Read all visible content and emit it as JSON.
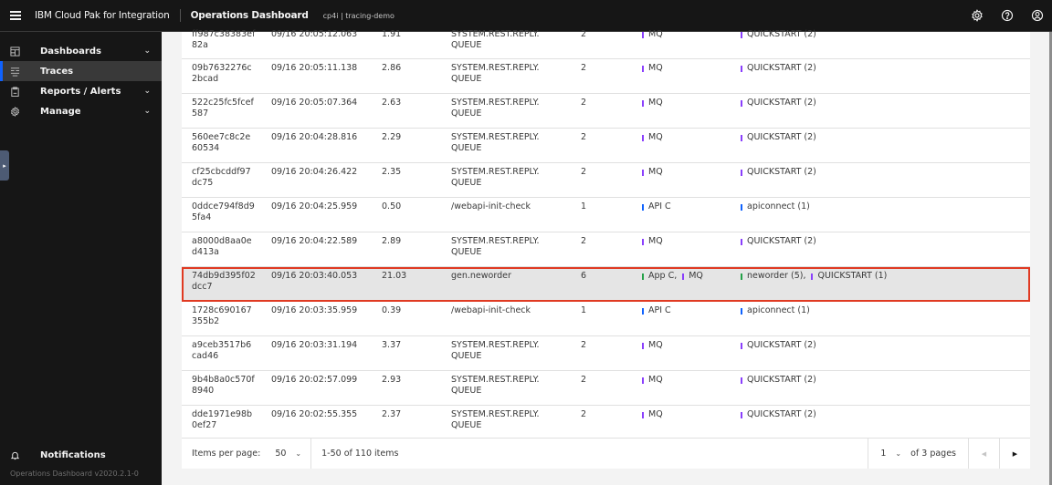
{
  "header": {
    "brand": "IBM Cloud Pak for Integration",
    "app_title": "Operations Dashboard",
    "namespace": "cp4i | tracing-demo",
    "icons": [
      "gear-icon",
      "help-icon",
      "user-avatar-icon"
    ]
  },
  "sidebar": {
    "items": [
      {
        "label": "Dashboards",
        "icon": "dashboard-icon",
        "expandable": true,
        "active": false
      },
      {
        "label": "Traces",
        "icon": "traces-icon",
        "expandable": false,
        "active": true
      },
      {
        "label": "Reports / Alerts",
        "icon": "clipboard-icon",
        "expandable": true,
        "active": false
      },
      {
        "label": "Manage",
        "icon": "gear-icon",
        "expandable": true,
        "active": false
      }
    ],
    "notifications_label": "Notifications",
    "version": "Operations Dashboard v2020.2.1-0"
  },
  "colors": {
    "mq": "#8a3ffc",
    "api": "#0f62fe",
    "app": "#24a148",
    "highlight_border": "#e03a22",
    "active_nav": "#0f62fe"
  },
  "table": {
    "rows": [
      {
        "id": "ff987c38383ef82a",
        "time": "09/16 20:05:12.063",
        "duration": "1.91",
        "name": "SYSTEM.REST.REPLY.QUEUE",
        "spans": "2",
        "types": [
          {
            "label": "MQ",
            "color": "mq"
          }
        ],
        "services": [
          {
            "label": "QUICKSTART (2)",
            "color": "mq"
          }
        ]
      },
      {
        "id": "09b7632276c2bcad",
        "time": "09/16 20:05:11.138",
        "duration": "2.86",
        "name": "SYSTEM.REST.REPLY.QUEUE",
        "spans": "2",
        "types": [
          {
            "label": "MQ",
            "color": "mq"
          }
        ],
        "services": [
          {
            "label": "QUICKSTART (2)",
            "color": "mq"
          }
        ]
      },
      {
        "id": "522c25fc5fcef587",
        "time": "09/16 20:05:07.364",
        "duration": "2.63",
        "name": "SYSTEM.REST.REPLY.QUEUE",
        "spans": "2",
        "types": [
          {
            "label": "MQ",
            "color": "mq"
          }
        ],
        "services": [
          {
            "label": "QUICKSTART (2)",
            "color": "mq"
          }
        ]
      },
      {
        "id": "560ee7c8c2e60534",
        "time": "09/16 20:04:28.816",
        "duration": "2.29",
        "name": "SYSTEM.REST.REPLY.QUEUE",
        "spans": "2",
        "types": [
          {
            "label": "MQ",
            "color": "mq"
          }
        ],
        "services": [
          {
            "label": "QUICKSTART (2)",
            "color": "mq"
          }
        ]
      },
      {
        "id": "cf25cbcddf97dc75",
        "time": "09/16 20:04:26.422",
        "duration": "2.35",
        "name": "SYSTEM.REST.REPLY.QUEUE",
        "spans": "2",
        "types": [
          {
            "label": "MQ",
            "color": "mq"
          }
        ],
        "services": [
          {
            "label": "QUICKSTART (2)",
            "color": "mq"
          }
        ]
      },
      {
        "id": "0ddce794f8d95fa4",
        "time": "09/16 20:04:25.959",
        "duration": "0.50",
        "name": "/webapi-init-check",
        "spans": "1",
        "types": [
          {
            "label": "API C",
            "color": "api"
          }
        ],
        "services": [
          {
            "label": "apiconnect (1)",
            "color": "api"
          }
        ]
      },
      {
        "id": "a8000d8aa0ed413a",
        "time": "09/16 20:04:22.589",
        "duration": "2.89",
        "name": "SYSTEM.REST.REPLY.QUEUE",
        "spans": "2",
        "types": [
          {
            "label": "MQ",
            "color": "mq"
          }
        ],
        "services": [
          {
            "label": "QUICKSTART (2)",
            "color": "mq"
          }
        ]
      },
      {
        "id": "74db9d395f02dcc7",
        "time": "09/16 20:03:40.053",
        "duration": "21.03",
        "name": "gen.neworder",
        "spans": "6",
        "highlighted": true,
        "types": [
          {
            "label": "App C,",
            "color": "app"
          },
          {
            "label": "MQ",
            "color": "mq"
          }
        ],
        "services": [
          {
            "label": "neworder (5),",
            "color": "app"
          },
          {
            "label": "QUICKSTART (1)",
            "color": "mq"
          }
        ]
      },
      {
        "id": "1728c690167355b2",
        "time": "09/16 20:03:35.959",
        "duration": "0.39",
        "name": "/webapi-init-check",
        "spans": "1",
        "types": [
          {
            "label": "API C",
            "color": "api"
          }
        ],
        "services": [
          {
            "label": "apiconnect (1)",
            "color": "api"
          }
        ]
      },
      {
        "id": "a9ceb3517b6cad46",
        "time": "09/16 20:03:31.194",
        "duration": "3.37",
        "name": "SYSTEM.REST.REPLY.QUEUE",
        "spans": "2",
        "types": [
          {
            "label": "MQ",
            "color": "mq"
          }
        ],
        "services": [
          {
            "label": "QUICKSTART (2)",
            "color": "mq"
          }
        ]
      },
      {
        "id": "9b4b8a0c570f8940",
        "time": "09/16 20:02:57.099",
        "duration": "2.93",
        "name": "SYSTEM.REST.REPLY.QUEUE",
        "spans": "2",
        "types": [
          {
            "label": "MQ",
            "color": "mq"
          }
        ],
        "services": [
          {
            "label": "QUICKSTART (2)",
            "color": "mq"
          }
        ]
      },
      {
        "id": "dde1971e98b0ef27",
        "time": "09/16 20:02:55.355",
        "duration": "2.37",
        "name": "SYSTEM.REST.REPLY.QUEUE",
        "spans": "2",
        "types": [
          {
            "label": "MQ",
            "color": "mq"
          }
        ],
        "services": [
          {
            "label": "QUICKSTART (2)",
            "color": "mq"
          }
        ]
      }
    ]
  },
  "pagination": {
    "items_per_page_label": "Items per page:",
    "items_per_page": "50",
    "range": "1-50 of 110 items",
    "current_page": "1",
    "total_pages_label": "of 3 pages"
  }
}
